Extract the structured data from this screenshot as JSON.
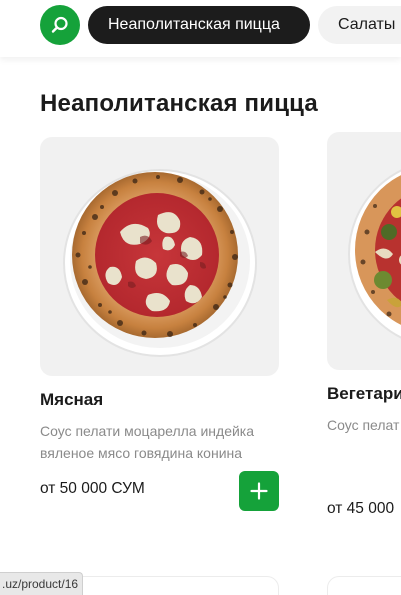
{
  "header": {
    "search_icon": "search-icon",
    "categories": [
      {
        "label": "Неаполитанская пицца",
        "active": true
      },
      {
        "label": "Салаты",
        "active": false
      }
    ]
  },
  "section": {
    "title": "Неаполитанская пицца"
  },
  "products": [
    {
      "name": "Мясная",
      "description": "Соус пелати моцарелла индейка вяленое мясо говядина конина",
      "price": "от 50 000 СУМ",
      "add_icon": "plus-icon"
    },
    {
      "name": "Вегетари",
      "description": "Соус пелат болгарский кабачки сп",
      "price": "от 45 000"
    }
  ],
  "status_bar": {
    "url": ".uz/product/16"
  },
  "colors": {
    "accent": "#15a23a",
    "chip_active": "#1c1c1c",
    "card_bg": "#f1f1f1"
  }
}
